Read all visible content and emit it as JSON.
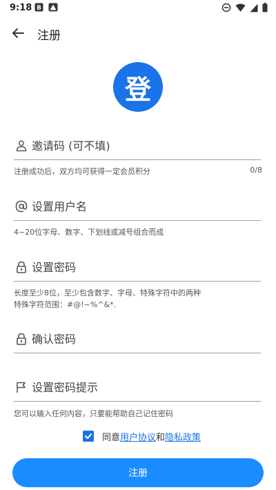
{
  "status_bar": {
    "time": "9:18",
    "left_icons": [
      "notification-b-icon",
      "warning-icon"
    ],
    "right_icons": [
      "dnd-icon",
      "wifi-icon",
      "signal-icon",
      "battery-icon"
    ]
  },
  "app_bar": {
    "title": "注册",
    "back_icon": "arrow-left-icon"
  },
  "logo": {
    "glyph": "登",
    "color": "#1a73e8"
  },
  "form": {
    "invite_code": {
      "placeholder": "邀请码 (可不填)",
      "value": "",
      "helper": "注册成功后，双方均可获得一定会员积分",
      "counter": "0/8",
      "icon": "person-icon"
    },
    "username": {
      "placeholder": "设置用户名",
      "value": "",
      "helper": "4~20位字母、数字、下划线或减号组合而成",
      "icon": "at-icon"
    },
    "password": {
      "placeholder": "设置密码",
      "value": "",
      "helper_line1": "长度至少8位，至少包含数字、字母、特殊字符中的两种",
      "helper_line2": "特殊字符范围：#@!~%^&*.",
      "icon": "lock-icon"
    },
    "confirm_password": {
      "placeholder": "确认密码",
      "value": "",
      "icon": "lock-icon"
    },
    "password_hint": {
      "placeholder": "设置密码提示",
      "value": "",
      "helper": "您可以输入任何内容，只要能帮助自己记住密码",
      "icon": "flag-icon"
    }
  },
  "agreement": {
    "checked": true,
    "prefix": "同意",
    "user_agreement": "用户协议",
    "conjunction": "和",
    "privacy_policy": "隐私政策"
  },
  "submit": {
    "label": "注册",
    "color": "#1a8cff"
  }
}
